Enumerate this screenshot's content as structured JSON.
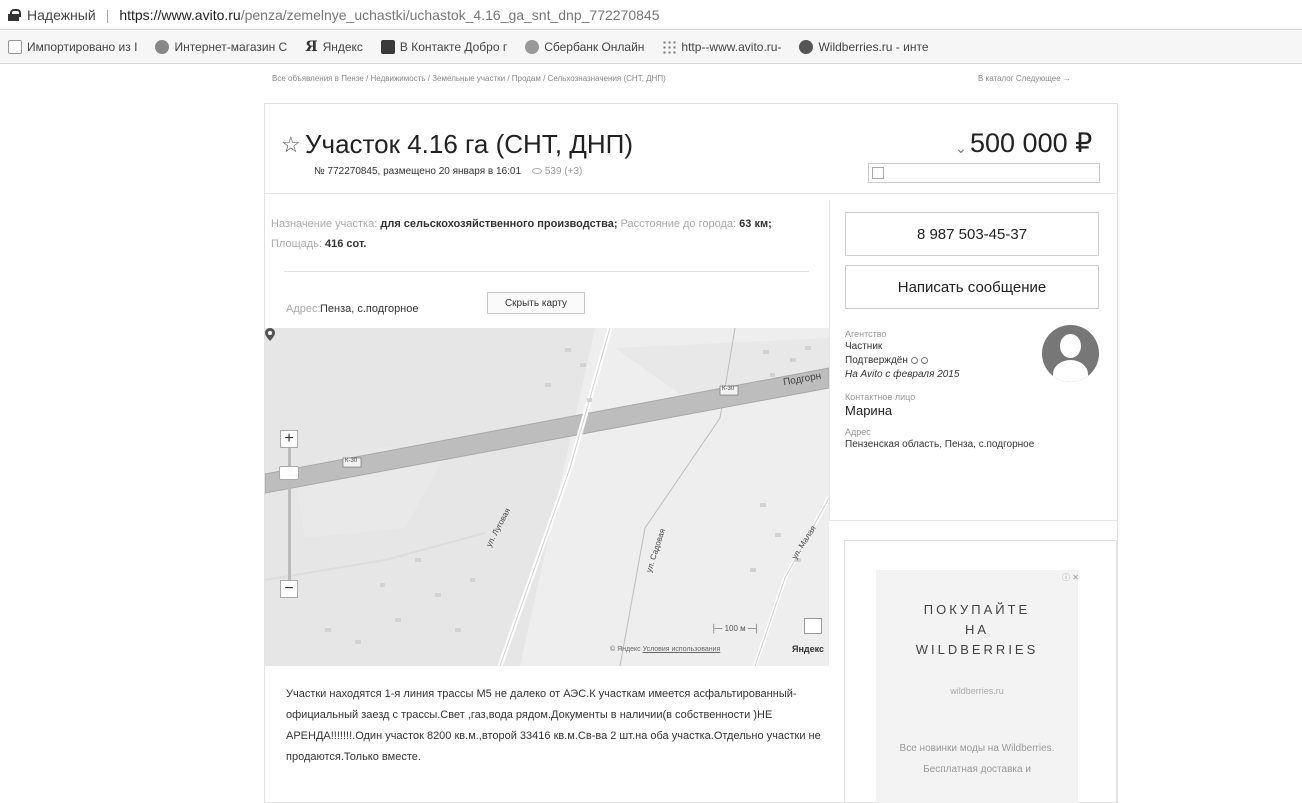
{
  "browser": {
    "secure_label": "Надежный",
    "url_host": "https://www.avito.ru",
    "url_path": "/penza/zemelnye_uchastki/uchastok_4.16_ga_snt_dnp_772270845",
    "bookmarks": [
      {
        "label": "Импортировано из I",
        "icon": "doc"
      },
      {
        "label": "Интернет-магазин С",
        "icon": "globe"
      },
      {
        "label": "Яндекс",
        "icon": "ya"
      },
      {
        "label": "В Контакте  Добро г",
        "icon": "vk"
      },
      {
        "label": "Сбербанк Онлайн",
        "icon": "sber"
      },
      {
        "label": "http--www.avito.ru-",
        "icon": "dots"
      },
      {
        "label": "Wildberries.ru - инте",
        "icon": "wb"
      }
    ]
  },
  "breadcrumbs": "Все объявления в Пензе / Недвижимость / Земельные участки / Продам / Сельхозназначения (СНТ, ДНП)",
  "breadcrumb_right": "В каталог   Следующее →",
  "listing": {
    "title": "Участок 4.16 га (СНТ, ДНП)",
    "meta": "№ 772270845, размещено 20 января в 16:01",
    "views": "539 (+3)",
    "price": "500 000 ₽",
    "params": {
      "purpose_label": "Назначение участка:",
      "purpose_value": "для сельскохозяйственного производства;",
      "distance_label": "Расстояние до города:",
      "distance_value": "63 км;",
      "area_label": "Площадь:",
      "area_value": "416 сот."
    },
    "address_label": "Адрес:",
    "address_value": "Пенза, с.подгорное",
    "hide_map_label": "Скрыть карту",
    "description": "Участки находятся 1-я линия трассы М5 не далеко от АЭС.К участкам имеется асфальтированный-официальный заезд с трассы.Свет ,газ,вода рядом.Документы в наличии(в собственности )НЕ АРЕНДА!!!!!!!.Один участок 8200 кв.м.,второй 33416 кв.м.Св-ва 2 шт.на оба участка.Отдельно участки не продаются.Только вместе."
  },
  "map": {
    "zoom_plus": "+",
    "zoom_minus": "−",
    "scale_label": "100 м",
    "copyright": "© Яндекс",
    "terms_link": "Условия использования",
    "logo": "Яндекс",
    "road_labels": [
      "Подгорн",
      "К-30",
      "К-30",
      "ул. Луговая",
      "ул. Садовая",
      "ул. Малая"
    ]
  },
  "contact": {
    "phone": "8 987 503-45-37",
    "message_button": "Написать сообщение",
    "agency_label": "Агентство",
    "seller_type": "Частник",
    "verified": "Подтверждён",
    "since": "На Avito с февраля 2015",
    "contact_label": "Контактное лицо",
    "contact_name": "Марина",
    "address_label": "Адрес",
    "address_value": "Пензенская область, Пенза, с.подгорное"
  },
  "ad": {
    "close": "ⓘ ✕",
    "title_line1": "ПОКУПАЙТЕ",
    "title_line2": "НА",
    "title_line3": "WILDBERRIES",
    "site": "wildberries.ru",
    "text": "Все новинки моды на Wildberries. Бесплатная доставка и"
  }
}
